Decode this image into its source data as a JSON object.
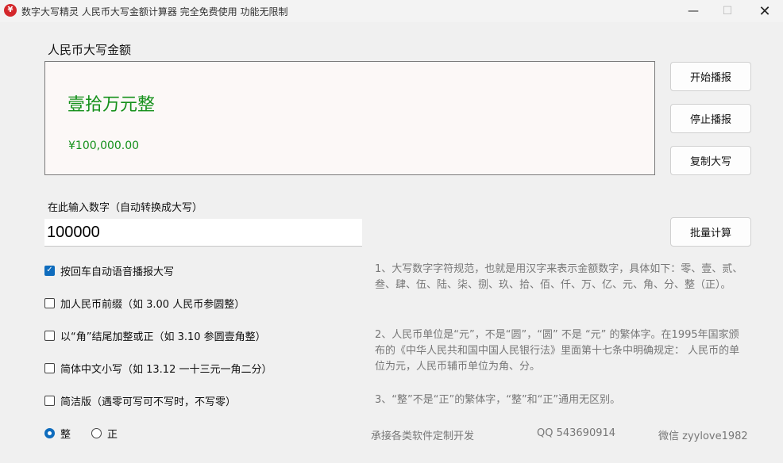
{
  "window": {
    "title": "数字大写精灵 人民币大写金额计算器  完全免费使用 功能无限制",
    "icon_char": "¥",
    "controls": {
      "minimize": "—",
      "maximize": "☐",
      "close": "✕"
    }
  },
  "result": {
    "section_label": "人民币大写金额",
    "upper_text": "壹拾万元整",
    "amount_text": "¥100,000.00",
    "color": "#14901a"
  },
  "buttons": {
    "start": "开始播报",
    "stop": "停止播报",
    "copy": "复制大写",
    "batch": "批量计算"
  },
  "input": {
    "label": "在此输入数字（自动转换成大写）",
    "value": "100000"
  },
  "options": [
    {
      "label": "按回车自动语音播报大写",
      "checked": true
    },
    {
      "label": "加人民币前缀（如 3.00 人民币参圆整）",
      "checked": false
    },
    {
      "label": "以“角”结尾加整或正（如 3.10 参圆壹角整）",
      "checked": false
    },
    {
      "label": "简体中文小写（如 13.12 一十三元一角二分）",
      "checked": false
    },
    {
      "label": "简洁版（遇零可写可不写时，不写零）",
      "checked": false
    }
  ],
  "radios": [
    {
      "label": "整",
      "selected": true
    },
    {
      "label": "正",
      "selected": false
    }
  ],
  "notes": [
    "1、大写数字字符规范，也就是用汉字来表示金额数字，具体如下：零、壹、贰、叁、肆、伍、陆、柒、捌、玖、拾、佰、仟、万、亿、元、角、分、整（正）。",
    "2、人民币单位是“元”，不是“圆”，“圆” 不是 “元” 的繁体字。在1995年国家颁布的《中华人民共和国中国人民银行法》里面第十七条中明确规定： 人民币的单位为元，人民币辅币单位为角、分。",
    "3、“整”不是“正”的繁体字，“整”和“正”通用无区别。"
  ],
  "footer": {
    "custom_dev": "承接各类软件定制开发",
    "qq": "QQ 543690914",
    "wechat": "微信 zyylove1982"
  },
  "colors": {
    "accent": "#0f6cbd",
    "note_text": "#777777"
  }
}
